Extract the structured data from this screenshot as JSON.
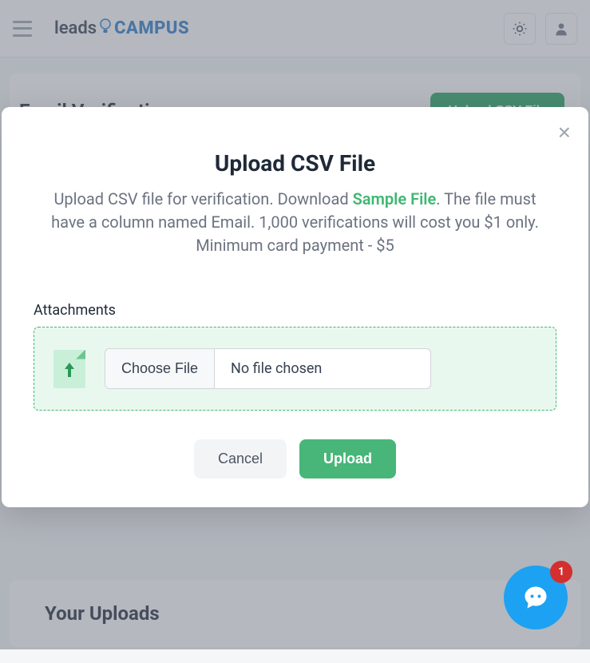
{
  "header": {
    "brand_part1": "leads",
    "brand_part2": "CAMPUS"
  },
  "page": {
    "title": "Email Verification",
    "upload_button": "Upload CSV File",
    "uploads_title": "Your Uploads"
  },
  "modal": {
    "title": "Upload CSV File",
    "desc_prefix": "Upload CSV file for verification. Download ",
    "sample_link": "Sample File",
    "desc_suffix": ". The file must have a column named Email. 1,000 verifications will cost you $1 only. Minimum card payment - $5",
    "attachments_label": "Attachments",
    "choose_file": "Choose File",
    "no_file": "No file chosen",
    "cancel": "Cancel",
    "upload": "Upload"
  },
  "chat": {
    "badge": "1"
  }
}
